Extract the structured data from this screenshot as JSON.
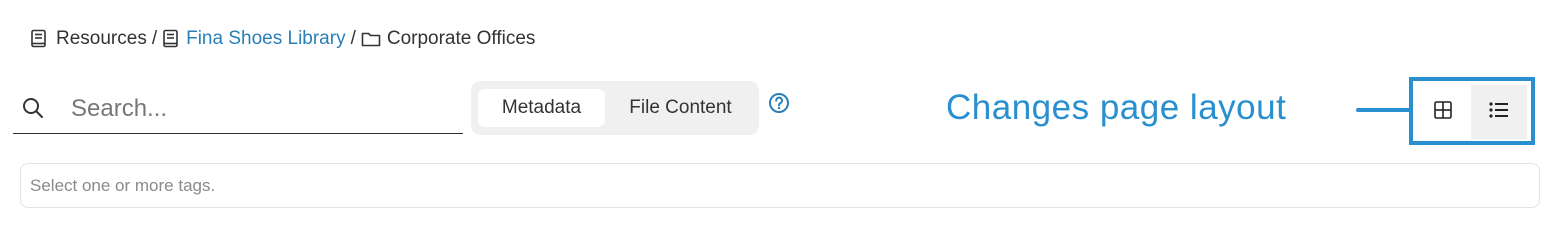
{
  "breadcrumb": [
    {
      "label": "Resources",
      "icon": "book-icon",
      "is_link": false
    },
    {
      "label": "Fina Shoes Library",
      "icon": "book-icon",
      "is_link": true
    },
    {
      "label": "Corporate Offices",
      "icon": "folder-icon",
      "is_link": false
    }
  ],
  "breadcrumb_separator": "/",
  "search": {
    "placeholder": "Search...",
    "value": "",
    "icon": "search-icon"
  },
  "search_mode": {
    "options": [
      "Metadata",
      "File Content"
    ],
    "selected": "Metadata"
  },
  "help_icon": "question-circle-icon",
  "annotation": {
    "text": "Changes page layout",
    "color": "#2a8fcf"
  },
  "view_toggle": {
    "options": [
      {
        "icon": "grid-view-icon"
      },
      {
        "icon": "list-view-icon"
      }
    ],
    "selected": "grid-view-icon"
  },
  "tags": {
    "placeholder": "Select one or more tags.",
    "value": ""
  },
  "colors": {
    "link": "#2a7fb8",
    "accent": "#2a8fcf",
    "segment_bg": "#f0f0f0"
  }
}
